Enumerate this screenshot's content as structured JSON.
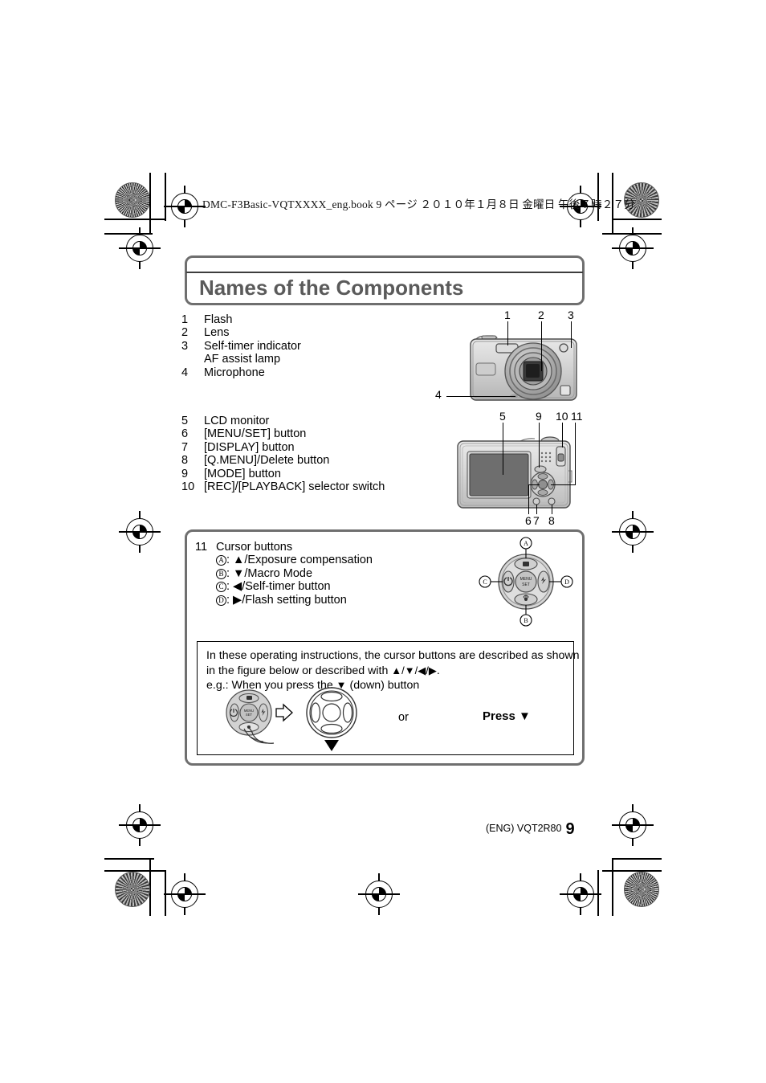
{
  "print_header": {
    "text": "DMC-F3Basic-VQTXXXX_eng.book   9 ページ   ２０１０年１月８日   金曜日   午後７時２７分"
  },
  "title": {
    "heading": "Names of the Components"
  },
  "parts_list_front": [
    {
      "num": "1",
      "label": "Flash"
    },
    {
      "num": "2",
      "label": "Lens"
    },
    {
      "num": "3",
      "label": "Self-timer indicator"
    },
    {
      "num": "",
      "label": "AF assist lamp"
    },
    {
      "num": "4",
      "label": "Microphone"
    }
  ],
  "parts_list_back": [
    {
      "num": "5",
      "label": "LCD monitor"
    },
    {
      "num": "6",
      "label": "[MENU/SET] button"
    },
    {
      "num": "7",
      "label": "[DISPLAY] button"
    },
    {
      "num": "8",
      "label": "[Q.MENU]/Delete button"
    },
    {
      "num": "9",
      "label": "[MODE] button"
    },
    {
      "num": "10",
      "label": "[REC]/[PLAYBACK] selector switch"
    }
  ],
  "cursor_section": {
    "num": "11",
    "title": "Cursor buttons",
    "items": [
      {
        "letter": "A",
        "text": ": ▲/Exposure compensation"
      },
      {
        "letter": "B",
        "text": ": ▼/Macro Mode"
      },
      {
        "letter": "C",
        "text": ": ◀/Self-timer button"
      },
      {
        "letter": "D",
        "text": ": ▶/Flash setting button"
      }
    ]
  },
  "note": {
    "line1": "In these operating instructions, the cursor buttons are described as shown",
    "line2_pre": "in the figure below or described with ",
    "line2_arrows": "▲/▼/◀/▶",
    "line2_post": ".",
    "line3_pre": "e.g.: When you press the ",
    "line3_arrow": "▼",
    "line3_post": " (down) button",
    "or_label": "or",
    "press_label": "Press ▼"
  },
  "figure_front": {
    "callouts": [
      {
        "id": "1",
        "text": "1"
      },
      {
        "id": "2",
        "text": "2"
      },
      {
        "id": "3",
        "text": "3"
      },
      {
        "id": "4",
        "text": "4"
      }
    ]
  },
  "figure_back": {
    "callouts": [
      {
        "id": "5",
        "text": "5"
      },
      {
        "id": "9",
        "text": "9"
      },
      {
        "id": "10",
        "text": "10"
      },
      {
        "id": "11",
        "text": "11"
      },
      {
        "id": "6",
        "text": "6"
      },
      {
        "id": "7",
        "text": "7"
      },
      {
        "id": "8",
        "text": "8"
      }
    ]
  },
  "figure_cursor": {
    "labels": [
      "A",
      "B",
      "C",
      "D"
    ],
    "center_label_line1": "MENU",
    "center_label_line2": "SET"
  },
  "footer": {
    "code": "(ENG) VQT2R80",
    "page": "9"
  },
  "colors": {
    "title_text": "#5a5a5a",
    "title_border": "#6f6f6f",
    "body_text": "#000000",
    "page_background": "#ffffff",
    "camera_body": "#c9c9c9",
    "lcd_screen": "#6e6e6e"
  }
}
